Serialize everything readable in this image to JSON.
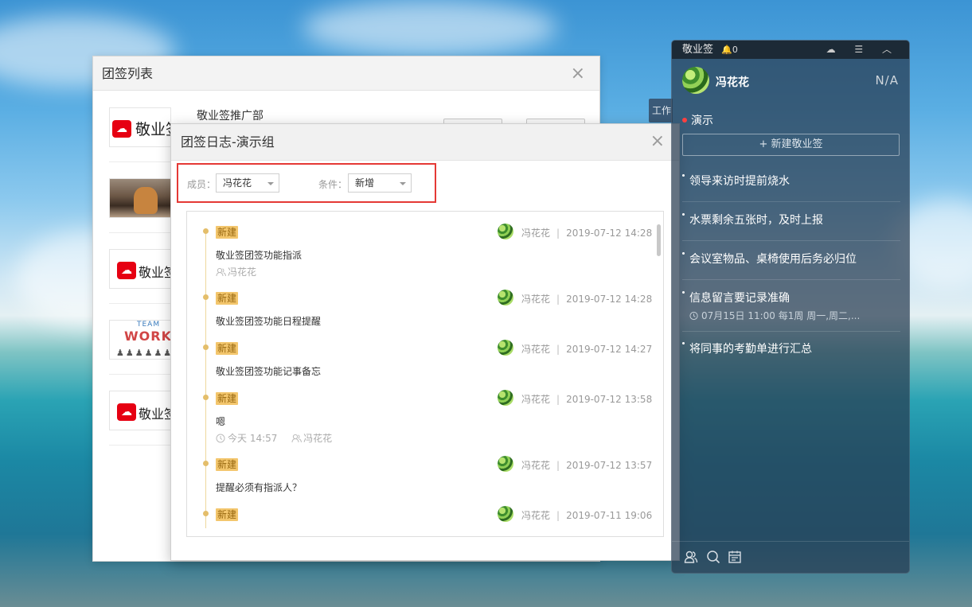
{
  "list_window": {
    "title": "团签列表",
    "close_glyph": "×",
    "groups": [
      {
        "name": "敬业签推广部",
        "logo_text": "敬业签",
        "logo_mark": "☁",
        "registered": "®"
      },
      {
        "name": ""
      },
      {
        "name": "",
        "logo_text": "敬业签",
        "logo_mark": "☁"
      },
      {
        "name": "",
        "team_text": "TEAM",
        "work_text": "WORK"
      },
      {
        "name": "",
        "logo_text": "敬业签",
        "logo_mark": "☁"
      }
    ]
  },
  "side_tab": {
    "label": "工作"
  },
  "log_window": {
    "title": "团签日志-演示组",
    "close_glyph": "×",
    "filters": {
      "member_label": "成员：",
      "member_value": "冯花花",
      "condition_label": "条件：",
      "condition_value": "新增"
    },
    "entries": [
      {
        "tag": "新建",
        "user": "冯花花",
        "time": "2019-07-12 14:28",
        "content": "敬业签团签功能指派",
        "assignee": "冯花花"
      },
      {
        "tag": "新建",
        "user": "冯花花",
        "time": "2019-07-12 14:28",
        "content": "敬业签团签功能日程提醒"
      },
      {
        "tag": "新建",
        "user": "冯花花",
        "time": "2019-07-12 14:27",
        "content": "敬业签团签功能记事备忘"
      },
      {
        "tag": "新建",
        "user": "冯花花",
        "time": "2019-07-12 13:58",
        "content": "嗯",
        "remind": "今天 14:57",
        "assignee": "冯花花"
      },
      {
        "tag": "新建",
        "user": "冯花花",
        "time": "2019-07-12 13:57",
        "content": "提醒必须有指派人？"
      },
      {
        "tag": "新建",
        "user": "冯花花",
        "time": "2019-07-11 19:06"
      }
    ],
    "separator": "|"
  },
  "side_panel": {
    "app_name": "敬业签",
    "bell_count": "0",
    "bell_glyph": "🔔",
    "tool_glyphs": "☁ ☰ ︿",
    "user_name": "冯花花",
    "status": "N/A",
    "group_name": "演示",
    "new_button": "+ 新建敬业签",
    "notes": [
      {
        "text": "领导来访时提前烧水"
      },
      {
        "text": "水票剩余五张时，及时上报"
      },
      {
        "text": "会议室物品、桌椅使用后务必归位"
      },
      {
        "text": "信息留言要记录准确",
        "remind": "07月15日 11:00 每1周 周一,周二,..."
      },
      {
        "text": "将同事的考勤单进行汇总"
      }
    ],
    "bottom_icons": [
      "contacts-icon",
      "search-icon",
      "calendar-icon"
    ]
  },
  "colors": {
    "tag_bg": "#f3c66d",
    "highlight_border": "#e53935",
    "panel_bg": "#283c50"
  }
}
